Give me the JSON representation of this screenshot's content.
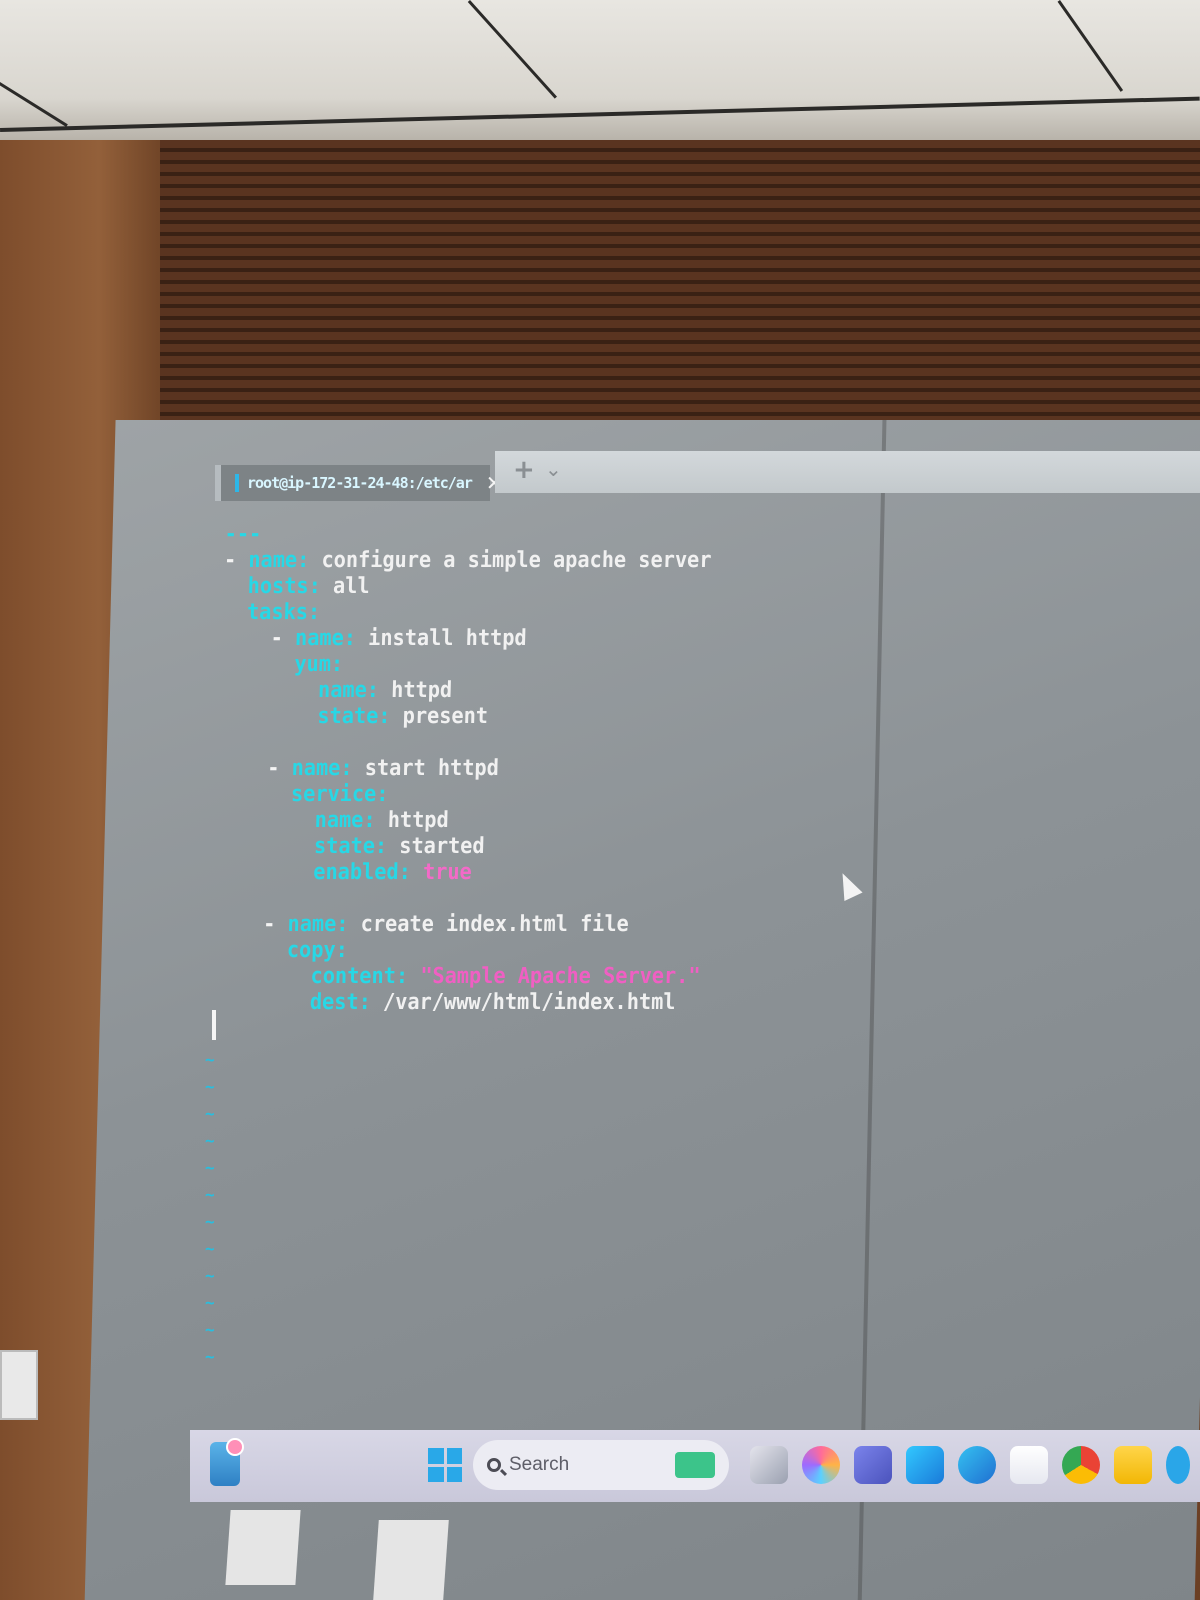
{
  "terminal": {
    "tab_title": "root@ip-172-31-24-48:/etc/ar",
    "tab_close": "✕",
    "new_tab": "+",
    "tab_dropdown": "⌄"
  },
  "code": {
    "line1": "---",
    "play_dash": "-",
    "play_name_key": "name:",
    "play_name_val": " configure a simple apache server",
    "hosts_key": "hosts:",
    "hosts_val": " all",
    "tasks_key": "tasks:",
    "t1_dash": "-",
    "t1_name_key": "name:",
    "t1_name_val": " install httpd",
    "t1_module": "yum:",
    "t1_p1_key": "name:",
    "t1_p1_val": " httpd",
    "t1_p2_key": "state:",
    "t1_p2_val": " present",
    "t2_dash": "-",
    "t2_name_key": "name:",
    "t2_name_val": " start httpd",
    "t2_module": "service:",
    "t2_p1_key": "name:",
    "t2_p1_val": " httpd",
    "t2_p2_key": "state:",
    "t2_p2_val": " started",
    "t2_p3_key": "enabled:",
    "t2_p3_val": "true",
    "t3_dash": "-",
    "t3_name_key": "name:",
    "t3_name_val": " create index.html file",
    "t3_module": "copy:",
    "t3_p1_key": "content:",
    "t3_p1_val": "\"Sample Apache Server.\"",
    "t3_p2_key": "dest:",
    "t3_p2_val": " /var/www/html/index.html"
  },
  "editor": {
    "tilde": "~"
  },
  "taskbar": {
    "search_label": "Search"
  }
}
